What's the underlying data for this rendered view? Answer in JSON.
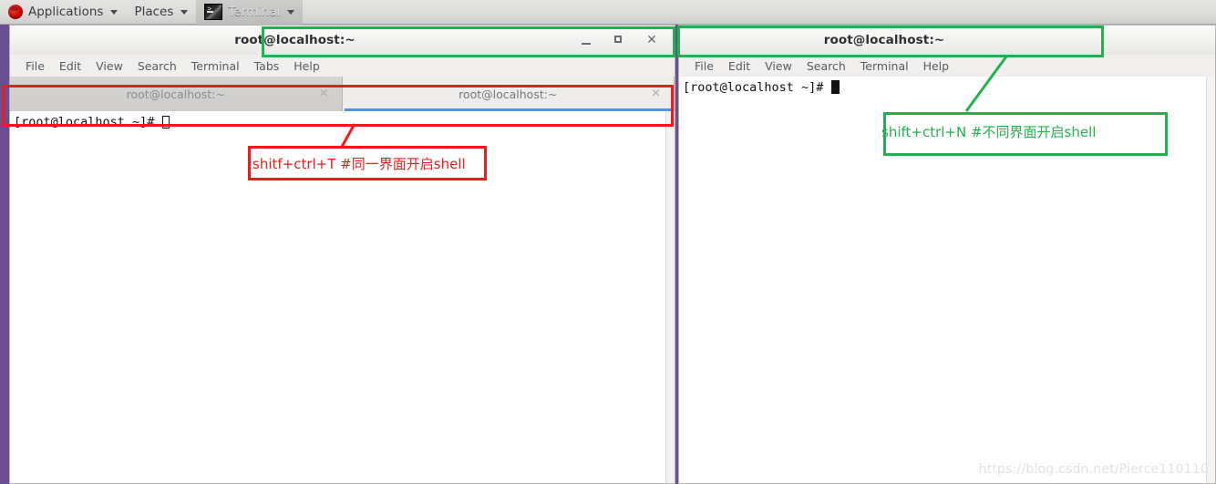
{
  "panel": {
    "logo_icon": "redhat-logo",
    "applications": "Applications",
    "places": "Places",
    "terminal_task": "Terminal",
    "terminal_icon": "terminal-icon",
    "caret_icon": "chevron-down-icon"
  },
  "window1": {
    "title": "root@localhost:~",
    "minimize_icon": "minimize-icon",
    "maximize_icon": "maximize-icon",
    "close_icon": "close-icon",
    "menu": [
      "File",
      "Edit",
      "View",
      "Search",
      "Terminal",
      "Tabs",
      "Help"
    ],
    "tabs": [
      {
        "label": "root@localhost:~",
        "active": false,
        "close_icon": "tab-close-icon"
      },
      {
        "label": "root@localhost:~",
        "active": true,
        "close_icon": "tab-close-icon"
      }
    ],
    "prompt": "[root@localhost ~]# ",
    "cursor": "hollow"
  },
  "window2": {
    "title": "root@localhost:~",
    "menu": [
      "File",
      "Edit",
      "View",
      "Search",
      "Terminal",
      "Help"
    ],
    "prompt": "[root@localhost ~]# ",
    "cursor": "solid"
  },
  "annotations": {
    "red": {
      "color": "#f01a1a",
      "text": "shitf+ctrl+T   #同一界面开启shell",
      "target": "window1-tabstrip"
    },
    "green_win1": {
      "color": "#22b14c",
      "target": "window1-titlebar"
    },
    "green_win2": {
      "color": "#22b14c",
      "text": "shift+ctrl+N   #不同界面开启shell",
      "target": "window2-titlebar"
    }
  },
  "watermark": "https://blog.csdn.net/Pierce110110"
}
